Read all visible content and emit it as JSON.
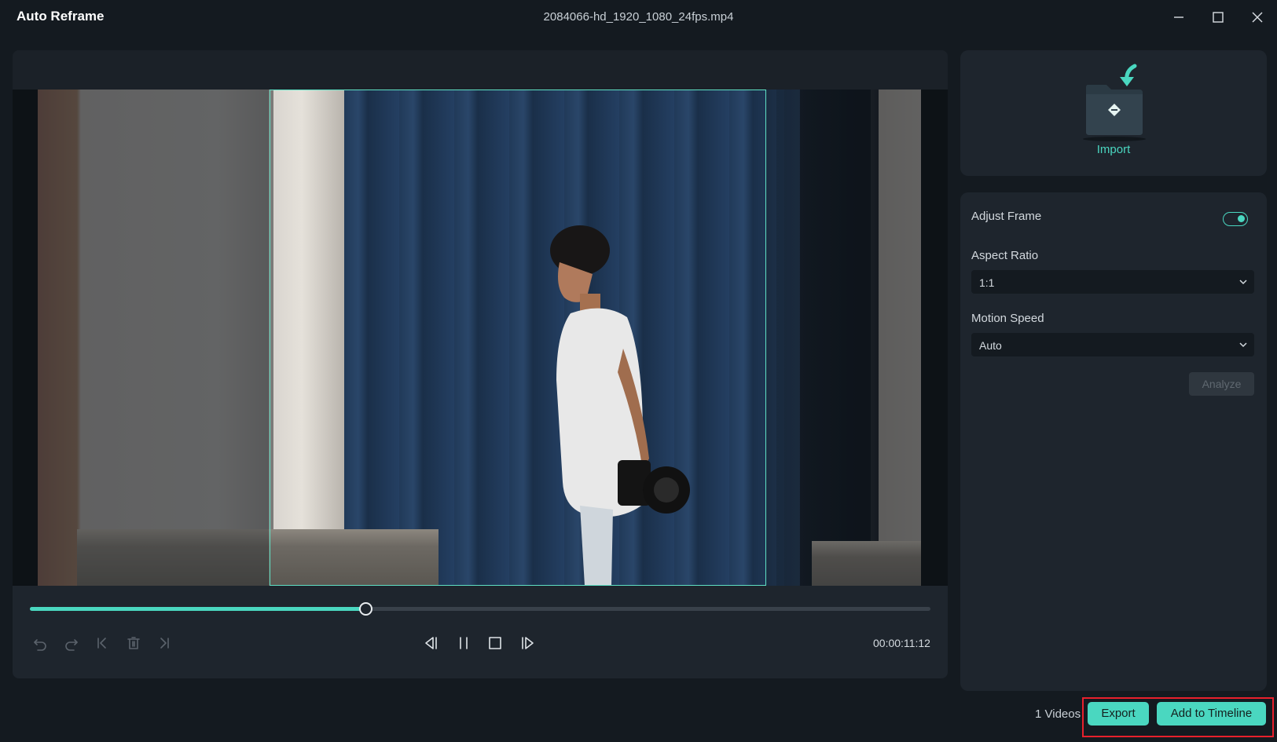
{
  "window": {
    "app_title": "Auto Reframe",
    "file_name": "2084066-hd_1920_1080_24fps.mp4",
    "controls": [
      "minimize-icon",
      "maximize-icon",
      "close-icon"
    ]
  },
  "player": {
    "progress_fraction": 0.373,
    "timecode": "00:00:11:12",
    "left_controls": [
      "undo-icon",
      "redo-icon",
      "skip-to-start-icon",
      "delete-icon",
      "skip-to-end-icon"
    ],
    "center_controls": [
      "previous-frame-icon",
      "pause-icon",
      "stop-icon",
      "next-frame-icon"
    ]
  },
  "import": {
    "label": "Import",
    "icon": "import-folder-icon"
  },
  "settings": {
    "adjust_frame_label": "Adjust Frame",
    "adjust_frame_on": true,
    "aspect_ratio_label": "Aspect Ratio",
    "aspect_ratio_value": "1:1",
    "motion_speed_label": "Motion Speed",
    "motion_speed_value": "Auto",
    "analyze_label": "Analyze"
  },
  "footer": {
    "videos_count": "1 Videos",
    "export_label": "Export",
    "add_to_timeline_label": "Add to Timeline"
  },
  "colors": {
    "accent": "#4ad7c0",
    "background": "#141a20",
    "panel": "#1e252d",
    "highlight": "#e8202c"
  }
}
